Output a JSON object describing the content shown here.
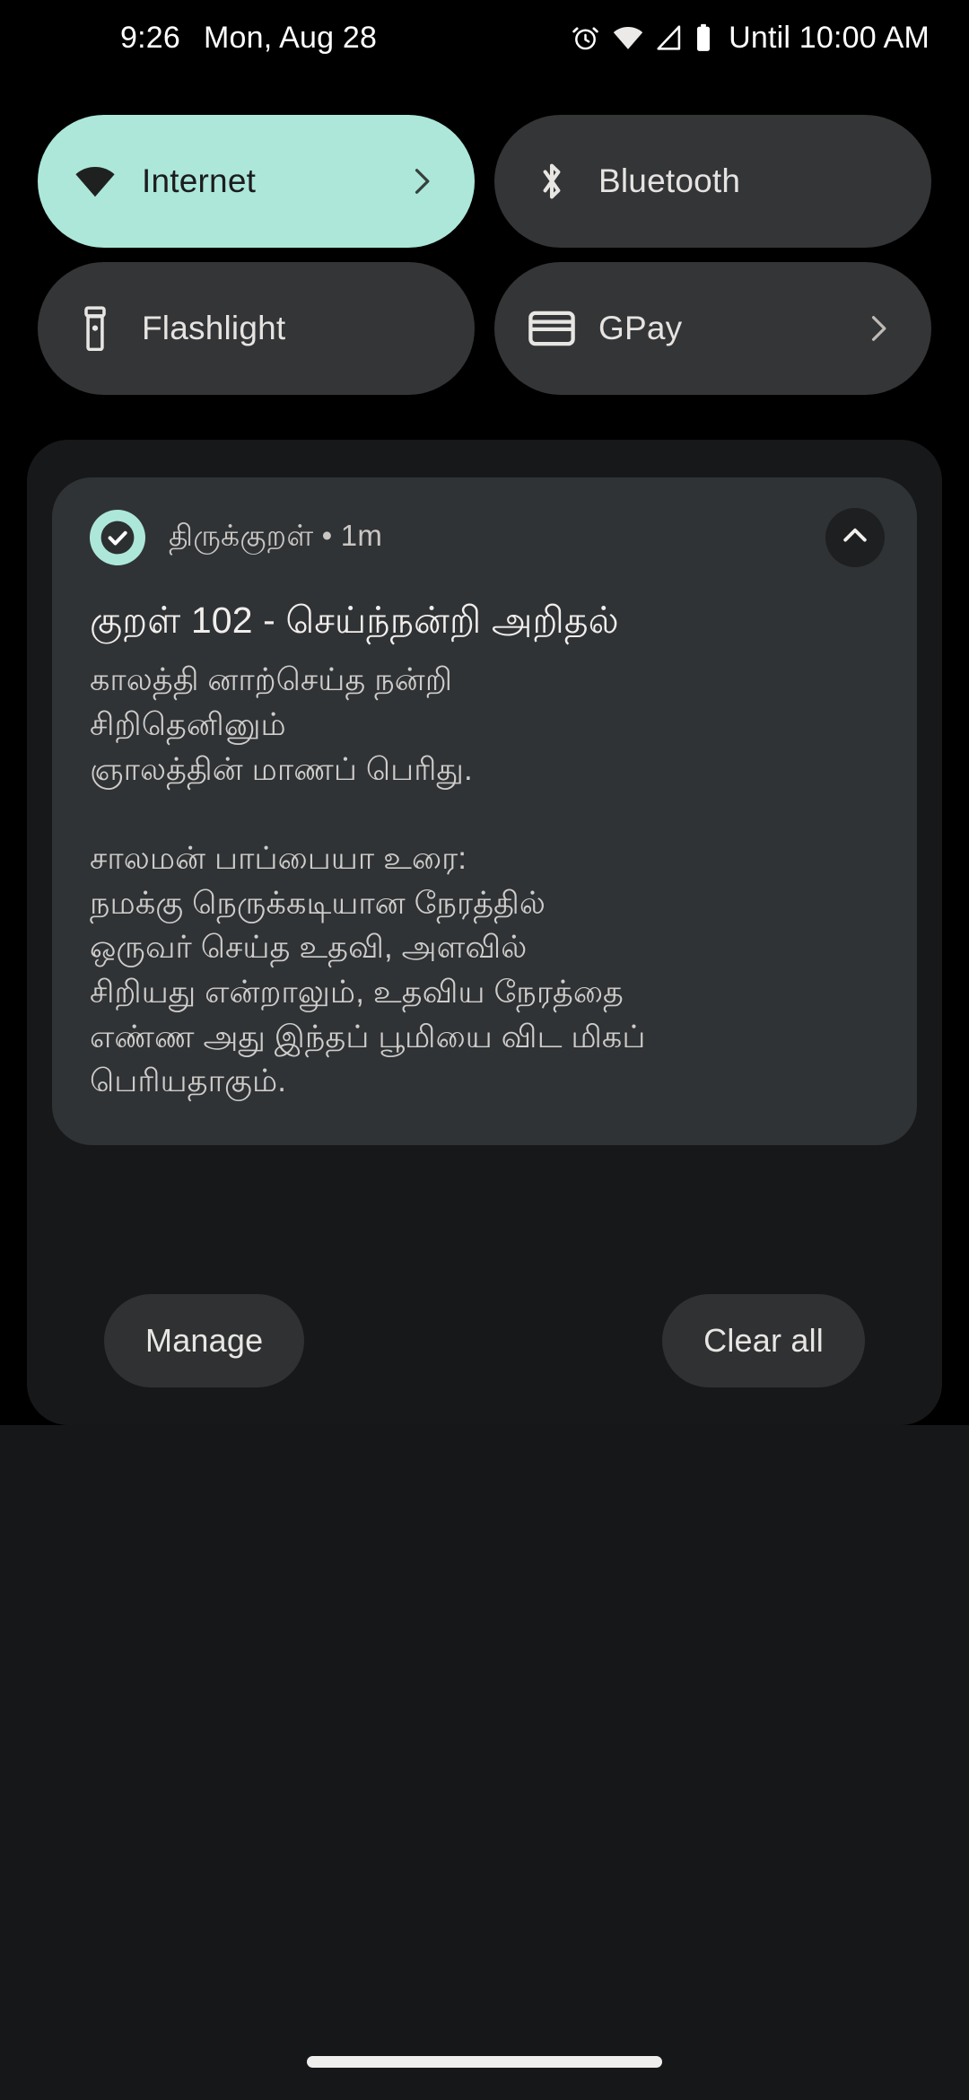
{
  "status_bar": {
    "time": "9:26",
    "date": "Mon, Aug 28",
    "alarm_text": "Until 10:00 AM",
    "icons": [
      "alarm-icon",
      "wifi-icon",
      "cellular-signal-icon",
      "battery-icon"
    ]
  },
  "quick_settings": {
    "tiles": [
      {
        "label": "Internet",
        "icon": "wifi-icon",
        "active": true,
        "chevron": true
      },
      {
        "label": "Bluetooth",
        "icon": "bluetooth-icon",
        "active": false,
        "chevron": false
      },
      {
        "label": "Flashlight",
        "icon": "flashlight-icon",
        "active": false,
        "chevron": false
      },
      {
        "label": "GPay",
        "icon": "credit-card-icon",
        "active": false,
        "chevron": true
      }
    ],
    "active_tile_color": "#ace7da",
    "inactive_tile_color": "#333537"
  },
  "notification": {
    "app_name": "திருக்குறள்",
    "separator": "•",
    "time_ago": "1m",
    "header_line": "திருக்குறள் • 1m",
    "app_icon": "check-circle-icon",
    "collapse_icon": "chevron-up-icon",
    "title": "குறள் 102 - செய்ந்நன்றி அறிதல்",
    "body": "காலத்தி னாற்செய்த நன்றி\nசிறிதெனினும்\nஞாலத்தின் மாணப் பெரிது.\n\nசாலமன் பாப்பையா உரை:\nநமக்கு நெருக்கடியான நேரத்தில்\nஒருவர் செய்த உதவி, அளவில்\nசிறியது என்றாலும், உதவிய நேரத்தை\nஎண்ண அது இந்தப் பூமியை விட மிகப்\nபெரியதாகும்."
  },
  "shade_actions": {
    "manage_label": "Manage",
    "clear_all_label": "Clear all"
  }
}
